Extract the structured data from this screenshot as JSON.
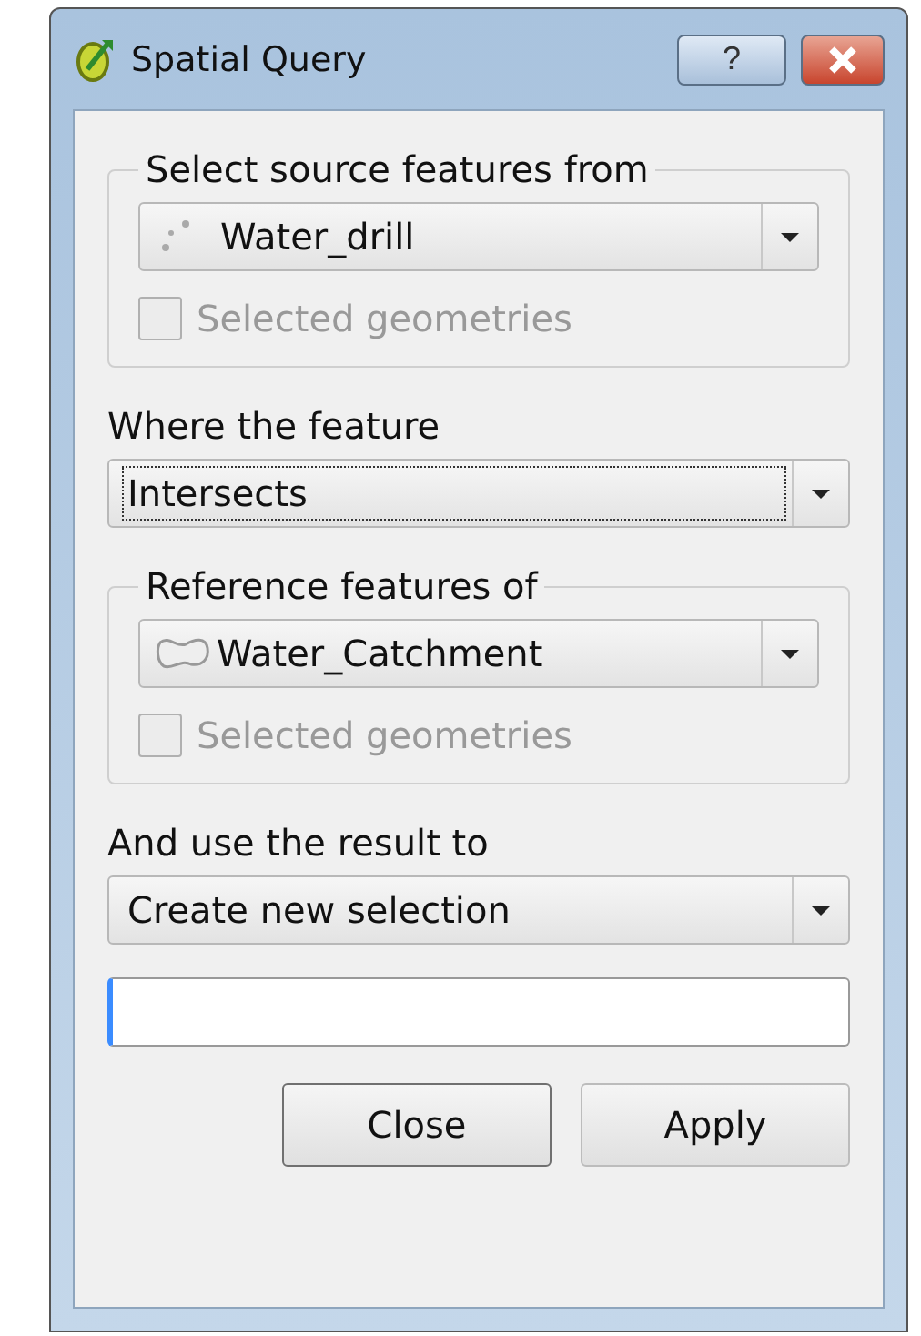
{
  "window": {
    "title": "Spatial Query",
    "help_button": "?"
  },
  "source": {
    "legend": "Select source features from",
    "layer": {
      "kind": "point",
      "name": "Water_drill"
    },
    "checkbox": {
      "label": "Selected geometries",
      "checked": false,
      "disabled": true
    }
  },
  "predicate": {
    "label": "Where the feature",
    "value": "Intersects",
    "focused": true
  },
  "reference": {
    "legend": "Reference features of",
    "layer": {
      "kind": "polygon",
      "name": "Water_Catchment"
    },
    "checkbox": {
      "label": "Selected geometries",
      "checked": false,
      "disabled": true
    }
  },
  "result": {
    "label": "And use the result to",
    "value": "Create new selection"
  },
  "buttons": [
    {
      "label": "Close",
      "default": true
    },
    {
      "label": "Apply",
      "default": false
    }
  ]
}
